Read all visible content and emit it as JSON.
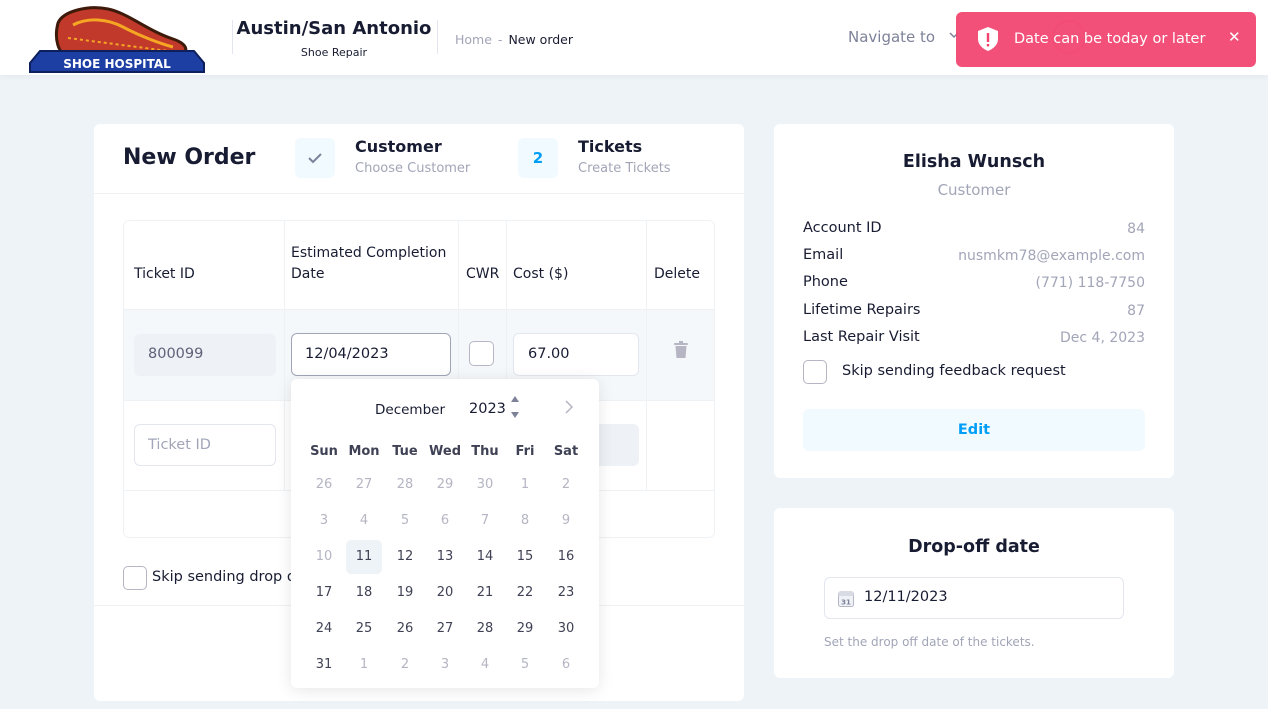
{
  "header": {
    "logo_text": "SHOE HOSPITAL",
    "store_name": "Austin/San Antonio",
    "store_sub": "Shoe Repair",
    "breadcrumb_home": "Home",
    "breadcrumb_sep": "-",
    "breadcrumb_current": "New order",
    "navigate_label": "Navigate to"
  },
  "toast": {
    "message": "Date can be today or later",
    "close": "✕"
  },
  "order": {
    "title": "New Order",
    "steps": [
      {
        "title": "Customer",
        "subtitle": "Choose Customer",
        "badge": "✓"
      },
      {
        "title": "Tickets",
        "subtitle": "Create Tickets",
        "badge": "2"
      }
    ],
    "columns": {
      "ticket_id": "Ticket ID",
      "completion_1": "Estimated Completion",
      "completion_2": "Date",
      "cwr": "CWR",
      "cost": "Cost ($)",
      "delete": "Delete"
    },
    "row1": {
      "ticket_id": "800099",
      "date": "12/04/2023",
      "cost": "67.00"
    },
    "row2": {
      "ticket_placeholder": "Ticket ID"
    },
    "skip_dropoff_label": "Skip sending drop off"
  },
  "calendar": {
    "month": "December",
    "year": "2023",
    "spin_up": "▲",
    "spin_down": "▼",
    "next": "›",
    "days_of_week": [
      "Sun",
      "Mon",
      "Tue",
      "Wed",
      "Thu",
      "Fri",
      "Sat"
    ],
    "weeks": [
      [
        "26",
        "27",
        "28",
        "29",
        "30",
        "1",
        "2"
      ],
      [
        "3",
        "4",
        "5",
        "6",
        "7",
        "8",
        "9"
      ],
      [
        "10",
        "11",
        "12",
        "13",
        "14",
        "15",
        "16"
      ],
      [
        "17",
        "18",
        "19",
        "20",
        "21",
        "22",
        "23"
      ],
      [
        "24",
        "25",
        "26",
        "27",
        "28",
        "29",
        "30"
      ],
      [
        "31",
        "1",
        "2",
        "3",
        "4",
        "5",
        "6"
      ]
    ]
  },
  "customer": {
    "name": "Elisha Wunsch",
    "role": "Customer",
    "fields": [
      {
        "label": "Account ID",
        "value": "84"
      },
      {
        "label": "Email",
        "value": "nusmkm78@example.com"
      },
      {
        "label": "Phone",
        "value": "(771) 118-7750"
      },
      {
        "label": "Lifetime Repairs",
        "value": "87"
      },
      {
        "label": "Last Repair Visit",
        "value": "Dec 4, 2023"
      }
    ],
    "skip_feedback_label": "Skip sending feedback request",
    "edit_label": "Edit"
  },
  "dropoff": {
    "title": "Drop-off date",
    "value": "12/11/2023",
    "calendar_icon_text": "31",
    "help": "Set the drop off date of the tickets."
  },
  "colors": {
    "primary": "#009ef7",
    "danger": "#f1416c",
    "background": "#eef3f8"
  }
}
